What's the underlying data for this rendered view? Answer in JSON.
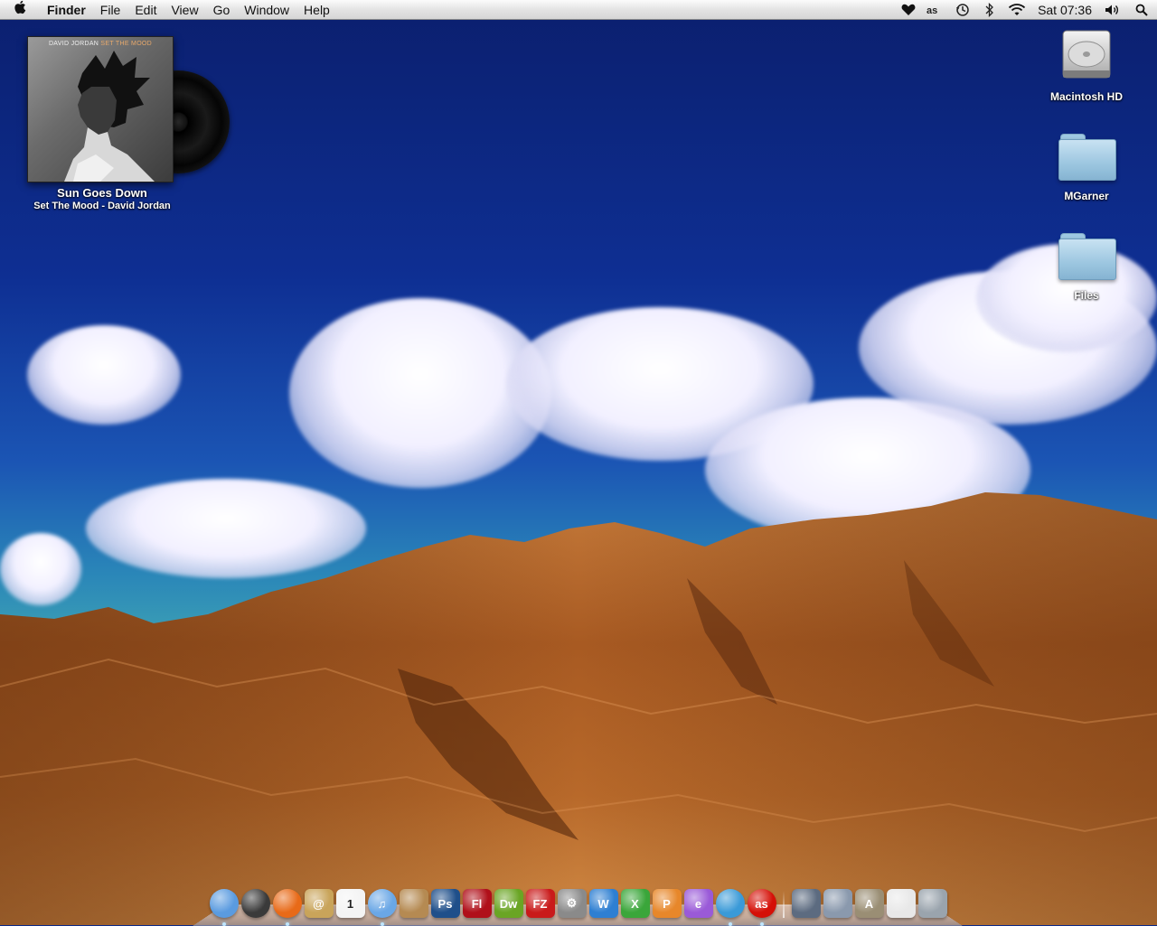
{
  "menubar": {
    "apple_glyph": "",
    "app_name": "Finder",
    "menus": [
      "File",
      "Edit",
      "View",
      "Go",
      "Window",
      "Help"
    ],
    "status_icons": [
      "heart-icon",
      "lastfm-icon",
      "time-machine-icon",
      "bluetooth-icon",
      "wifi-icon"
    ],
    "clock": "Sat 07:36",
    "volume_icon": "volume-icon",
    "spotlight_icon": "spotlight-search-icon"
  },
  "desktop": {
    "now_playing": {
      "cover_artist": "DAVID JORDAN",
      "cover_album": "SET THE MOOD",
      "track": "Sun Goes Down",
      "subtitle": "Set The Mood - David Jordan"
    },
    "icons": [
      {
        "label": "Macintosh HD",
        "type": "drive"
      },
      {
        "label": "MGarner",
        "type": "folder"
      },
      {
        "label": "Files",
        "type": "folder"
      }
    ]
  },
  "dock": {
    "apps": [
      {
        "name": "finder-icon",
        "text": "",
        "color": "#5a9be0",
        "running": true
      },
      {
        "name": "dashboard-icon",
        "text": "",
        "color": "#3a3a3a",
        "running": false
      },
      {
        "name": "firefox-icon",
        "text": "",
        "color": "#e86a18",
        "running": true
      },
      {
        "name": "address-book-icon",
        "text": "@",
        "color": "#c9a45a",
        "running": false
      },
      {
        "name": "ical-icon",
        "text": "1",
        "color": "#f4f4f4",
        "running": false
      },
      {
        "name": "itunes-icon",
        "text": "♫",
        "color": "#6aa7e6",
        "running": true
      },
      {
        "name": "iphoto-icon",
        "text": "",
        "color": "#b58a52",
        "running": false
      },
      {
        "name": "photoshop-icon",
        "text": "Ps",
        "color": "#1f4f8a",
        "running": false
      },
      {
        "name": "flash-icon",
        "text": "Fl",
        "color": "#b0101a",
        "running": false
      },
      {
        "name": "dreamweaver-icon",
        "text": "Dw",
        "color": "#6aa524",
        "running": false
      },
      {
        "name": "filezilla-icon",
        "text": "FZ",
        "color": "#c91a1a",
        "running": false
      },
      {
        "name": "system-preferences-icon",
        "text": "⚙",
        "color": "#8a8a8a",
        "running": false
      },
      {
        "name": "word-icon",
        "text": "W",
        "color": "#2e7fd2",
        "running": false
      },
      {
        "name": "excel-icon",
        "text": "X",
        "color": "#3aa63a",
        "running": false
      },
      {
        "name": "powerpoint-icon",
        "text": "P",
        "color": "#e7872a",
        "running": false
      },
      {
        "name": "entourage-icon",
        "text": "e",
        "color": "#9a5ad8",
        "running": false
      },
      {
        "name": "messenger-icon",
        "text": "",
        "color": "#3a9ad8",
        "running": true
      },
      {
        "name": "lastfm-app-icon",
        "text": "as",
        "color": "#d51007",
        "running": true
      }
    ],
    "stacks": [
      {
        "name": "documents-stack-icon",
        "text": "",
        "color": "#5c6b80"
      },
      {
        "name": "downloads-stack-icon",
        "text": "",
        "color": "#8a99ad"
      },
      {
        "name": "applications-stack-icon",
        "text": "A",
        "color": "#9a8e74"
      },
      {
        "name": "mail-stack-icon",
        "text": "",
        "color": "#e8e8e8"
      },
      {
        "name": "trash-icon",
        "text": "",
        "color": "#9aa4ad"
      }
    ]
  }
}
